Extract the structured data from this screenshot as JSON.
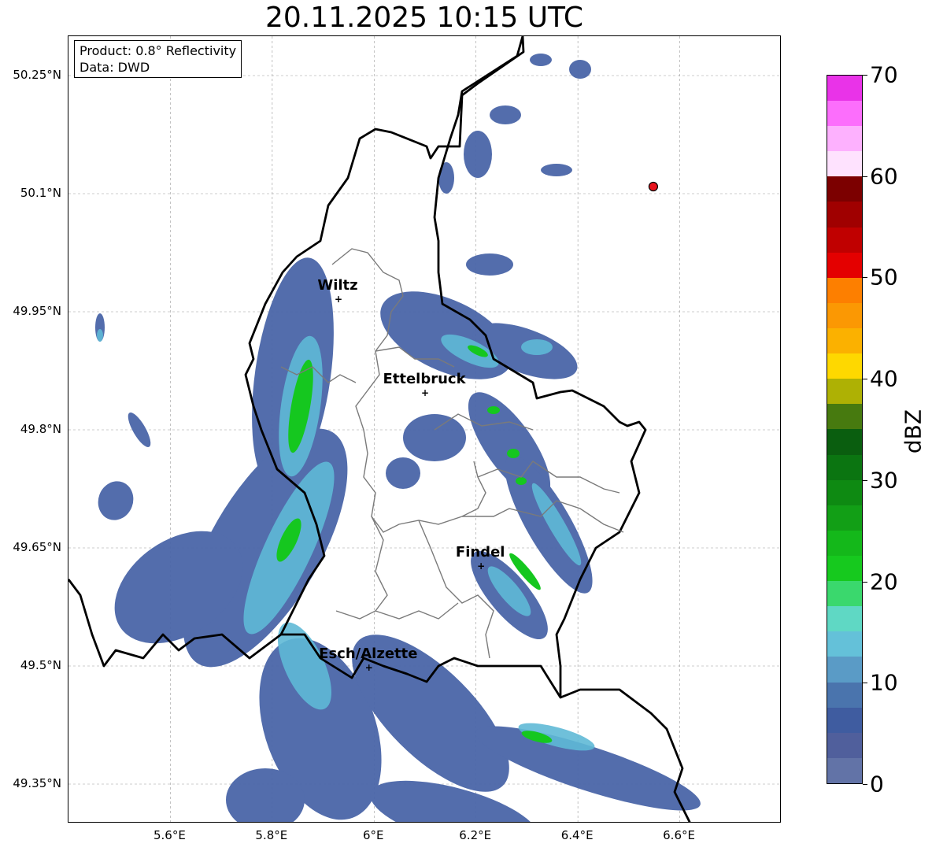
{
  "title": "20.11.2025 10:15 UTC",
  "info": {
    "product": "Product: 0.8° Reflectivity",
    "source": "Data: DWD"
  },
  "lat_ticks": [
    "50.25°N",
    "50.1°N",
    "49.95°N",
    "49.8°N",
    "49.65°N",
    "49.5°N",
    "49.35°N"
  ],
  "lon_ticks": [
    "5.6°E",
    "5.8°E",
    "6°E",
    "6.2°E",
    "6.4°E",
    "6.6°E"
  ],
  "cities": [
    {
      "name": "Wiltz",
      "lon": 5.93,
      "lat": 49.966
    },
    {
      "name": "Ettelbruck",
      "lon": 6.1,
      "lat": 49.847
    },
    {
      "name": "Findel",
      "lon": 6.21,
      "lat": 49.627
    },
    {
      "name": "Esch/Alzette",
      "lon": 5.99,
      "lat": 49.498
    }
  ],
  "radar_site": {
    "lon": 6.548,
    "lat": 50.109
  },
  "colorbar": {
    "label": "dBZ",
    "ticks": [
      "0",
      "10",
      "20",
      "30",
      "40",
      "50",
      "60",
      "70"
    ],
    "range": [
      0,
      70
    ],
    "colors": [
      "#6273a7",
      "#505f9c",
      "#3f5ca0",
      "#4a74ad",
      "#5a9bc6",
      "#64c1d9",
      "#5fd8c4",
      "#3ad86d",
      "#16c91e",
      "#14b81a",
      "#129f16",
      "#0e8a12",
      "#0b7511",
      "#0a5e0f",
      "#477a0f",
      "#aeb104",
      "#fed800",
      "#fbb100",
      "#fb9803",
      "#fd7f00",
      "#e40000",
      "#c00000",
      "#a00000",
      "#7c0000",
      "#fee2fe",
      "#fdb1fe",
      "#fc6efc",
      "#e933e8"
    ]
  },
  "map_extent": {
    "lon": [
      5.4,
      6.8
    ],
    "lat": [
      49.3,
      50.3
    ]
  }
}
